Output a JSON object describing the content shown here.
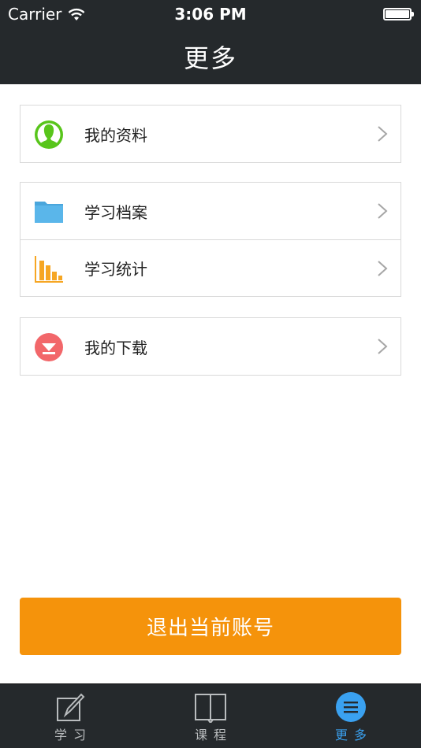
{
  "status_bar": {
    "carrier": "Carrier",
    "time": "3:06 PM"
  },
  "nav": {
    "title": "更多"
  },
  "menu": {
    "profile": "我的资料",
    "archive": "学习档案",
    "stats": "学习统计",
    "downloads": "我的下载"
  },
  "logout_label": "退出当前账号",
  "tabs": {
    "study": "学习",
    "courses": "课程",
    "more": "更多"
  },
  "colors": {
    "bar_bg": "#25292c",
    "accent_orange": "#f5930b",
    "tab_active": "#3aa1f0",
    "profile_green": "#58c51b",
    "folder_blue": "#5ab6ea",
    "stats_orange": "#f6a623",
    "download_red": "#f2676a"
  },
  "icons": {
    "profile": "user-avatar-icon",
    "archive": "folder-icon",
    "stats": "bar-chart-icon",
    "downloads": "download-arrow-icon",
    "tab_study": "pencil-square-icon",
    "tab_courses": "open-book-icon",
    "tab_more": "menu-lines-icon"
  }
}
